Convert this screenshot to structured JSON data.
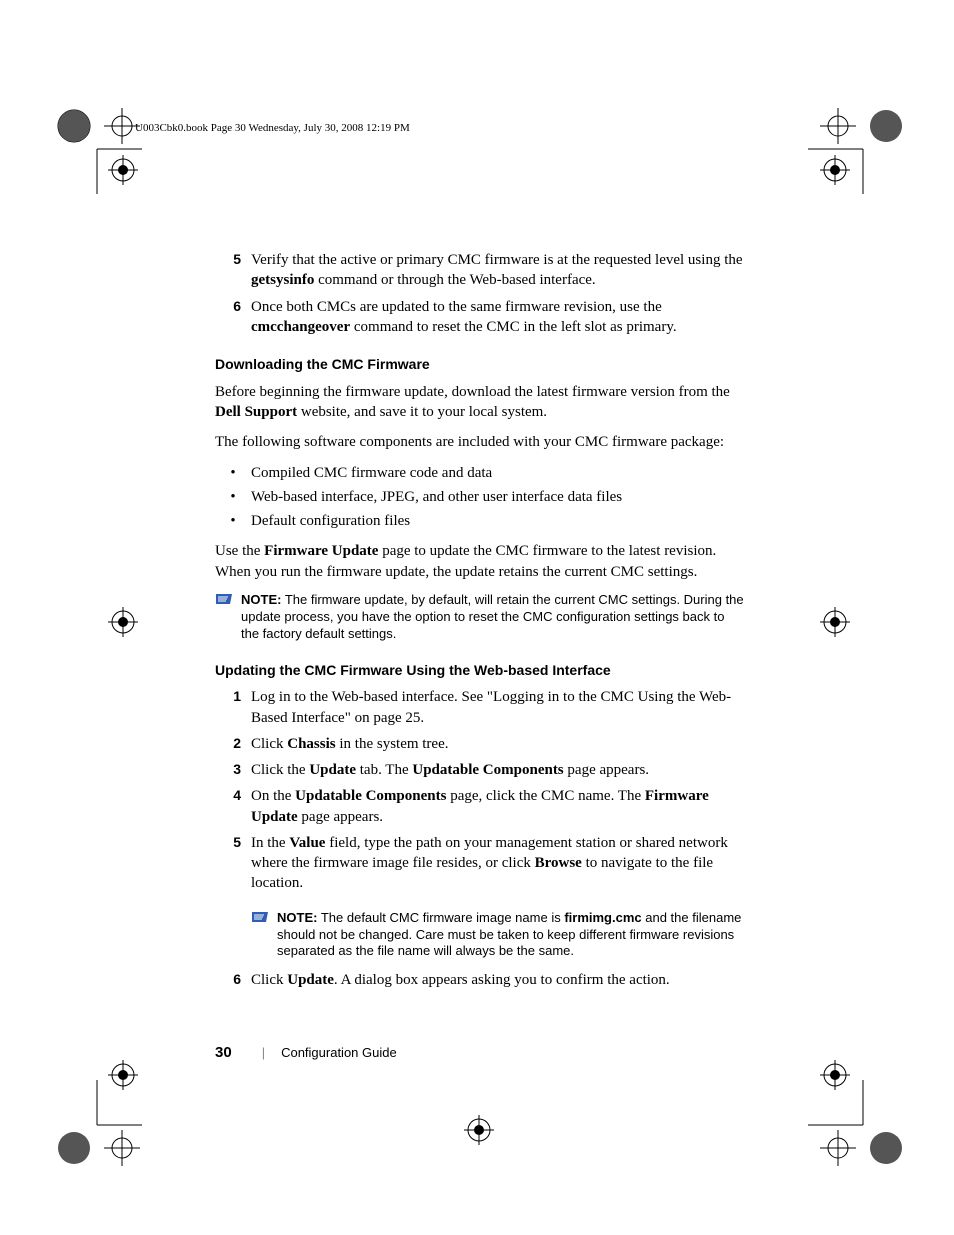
{
  "header": {
    "text": "U003Cbk0.book  Page 30  Wednesday, July 30, 2008  12:19 PM"
  },
  "steps_top": [
    {
      "n": "5",
      "segments": [
        {
          "t": "Verify that the active or primary CMC firmware is at the requested level using the "
        },
        {
          "t": "getsysinfo",
          "b": true
        },
        {
          "t": " command or through the Web-based interface."
        }
      ]
    },
    {
      "n": "6",
      "segments": [
        {
          "t": "Once both CMCs are updated to the same firmware revision, use the "
        },
        {
          "t": "cmcchangeover",
          "b": true
        },
        {
          "t": " command to reset the CMC in the left slot as primary."
        }
      ]
    }
  ],
  "h_download": "Downloading the CMC Firmware",
  "p_before": [
    {
      "t": "Before beginning the firmware update, download the latest firmware version from the "
    },
    {
      "t": "Dell Support",
      "b": true
    },
    {
      "t": " website, and save it to your local system."
    }
  ],
  "p_components": "The following software components are included with your CMC firmware package:",
  "bullets": [
    "Compiled CMC firmware code and data",
    "Web-based interface, JPEG, and other user interface data files",
    "Default configuration files"
  ],
  "p_use": [
    {
      "t": "Use the "
    },
    {
      "t": "Firmware Update",
      "b": true
    },
    {
      "t": " page to update the CMC firmware to the latest revision. When you run the firmware update, the update retains the current CMC settings."
    }
  ],
  "note1": {
    "label": "NOTE:",
    "text": " The firmware update, by default, will retain the current CMC settings. During the update process, you have the option to reset the CMC configuration settings back to the factory default settings."
  },
  "h_update": "Updating the CMC Firmware Using the Web-based Interface",
  "steps_bottom": [
    {
      "n": "1",
      "segments": [
        {
          "t": "Log in to the Web-based interface. See \"Logging in to the CMC Using the Web-Based Interface\" on page 25."
        }
      ]
    },
    {
      "n": "2",
      "segments": [
        {
          "t": "Click "
        },
        {
          "t": "Chassis",
          "b": true
        },
        {
          "t": " in the system tree."
        }
      ]
    },
    {
      "n": "3",
      "segments": [
        {
          "t": "Click the "
        },
        {
          "t": "Update",
          "b": true
        },
        {
          "t": " tab. The "
        },
        {
          "t": "Updatable Components",
          "b": true
        },
        {
          "t": " page appears."
        }
      ]
    },
    {
      "n": "4",
      "segments": [
        {
          "t": "On the "
        },
        {
          "t": "Updatable Components",
          "b": true
        },
        {
          "t": " page, click the CMC name. The "
        },
        {
          "t": "Firmware Update",
          "b": true
        },
        {
          "t": " page appears."
        }
      ]
    },
    {
      "n": "5",
      "segments": [
        {
          "t": "In the "
        },
        {
          "t": "Value",
          "b": true
        },
        {
          "t": " field, type the path on your management station or shared network where the firmware image file resides, or click "
        },
        {
          "t": "Browse",
          "b": true
        },
        {
          "t": " to navigate to the file location."
        }
      ]
    }
  ],
  "note2": {
    "label": "NOTE:",
    "segments": [
      {
        "t": " The default CMC firmware image name is "
      },
      {
        "t": "firmimg.cmc",
        "b": true,
        "sans": true
      },
      {
        "t": " and the filename should not be changed. Care must be taken to keep different firmware revisions separated as the file name will always be the same."
      }
    ]
  },
  "step6": {
    "n": "6",
    "segments": [
      {
        "t": "Click "
      },
      {
        "t": "Update",
        "b": true
      },
      {
        "t": ". A dialog box appears asking you to confirm the action."
      }
    ]
  },
  "footer": {
    "page_number": "30",
    "doc_title": "Configuration Guide"
  }
}
